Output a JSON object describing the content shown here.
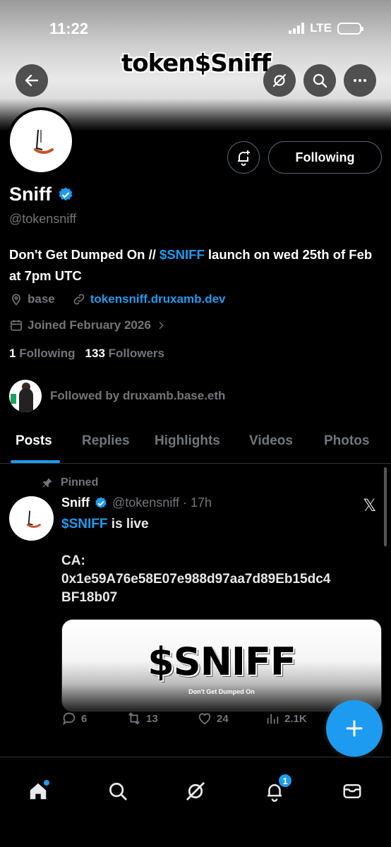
{
  "status_bar": {
    "time": "11:22",
    "network": "LTE"
  },
  "header": {
    "logo_text": "token$Sniff"
  },
  "profile": {
    "follow_button": "Following",
    "name": "Sniff",
    "handle": "@tokensniff",
    "bio_part1": "Don't Get Dumped On // ",
    "bio_ticker": "$SNIFF",
    "bio_part2": " launch on wed 25th of Feb at 7pm UTC",
    "location": "base",
    "website": "tokensniff.druxamb.dev",
    "joined": "Joined February 2026",
    "following_count": "1",
    "following_label": "Following",
    "followers_count": "133",
    "followers_label": "Followers",
    "followed_by": "Followed by druxamb.base.eth"
  },
  "tabs": [
    "Posts",
    "Replies",
    "Highlights",
    "Videos",
    "Photos"
  ],
  "post": {
    "pinned_label": "Pinned",
    "author_name": "Sniff",
    "author_handle": "@tokensniff · 17h",
    "x_logo": "𝕏",
    "ticker": "$SNIFF",
    "live_text": " is live",
    "ca_label": "CA:",
    "ca_line1": "0x1e59A76e58E07e988d97aa7d89Eb15dc4",
    "ca_line2": "BF18b07",
    "image_title": "$SNIFF",
    "image_tagline": "Don't Get Dumped On",
    "replies": "6",
    "reposts": "13",
    "likes": "24",
    "views": "2.1K"
  },
  "bottom_nav": {
    "notification_badge": "1"
  },
  "colors": {
    "accent": "#1d9bf0",
    "background": "#000000",
    "muted": "#71767b"
  }
}
